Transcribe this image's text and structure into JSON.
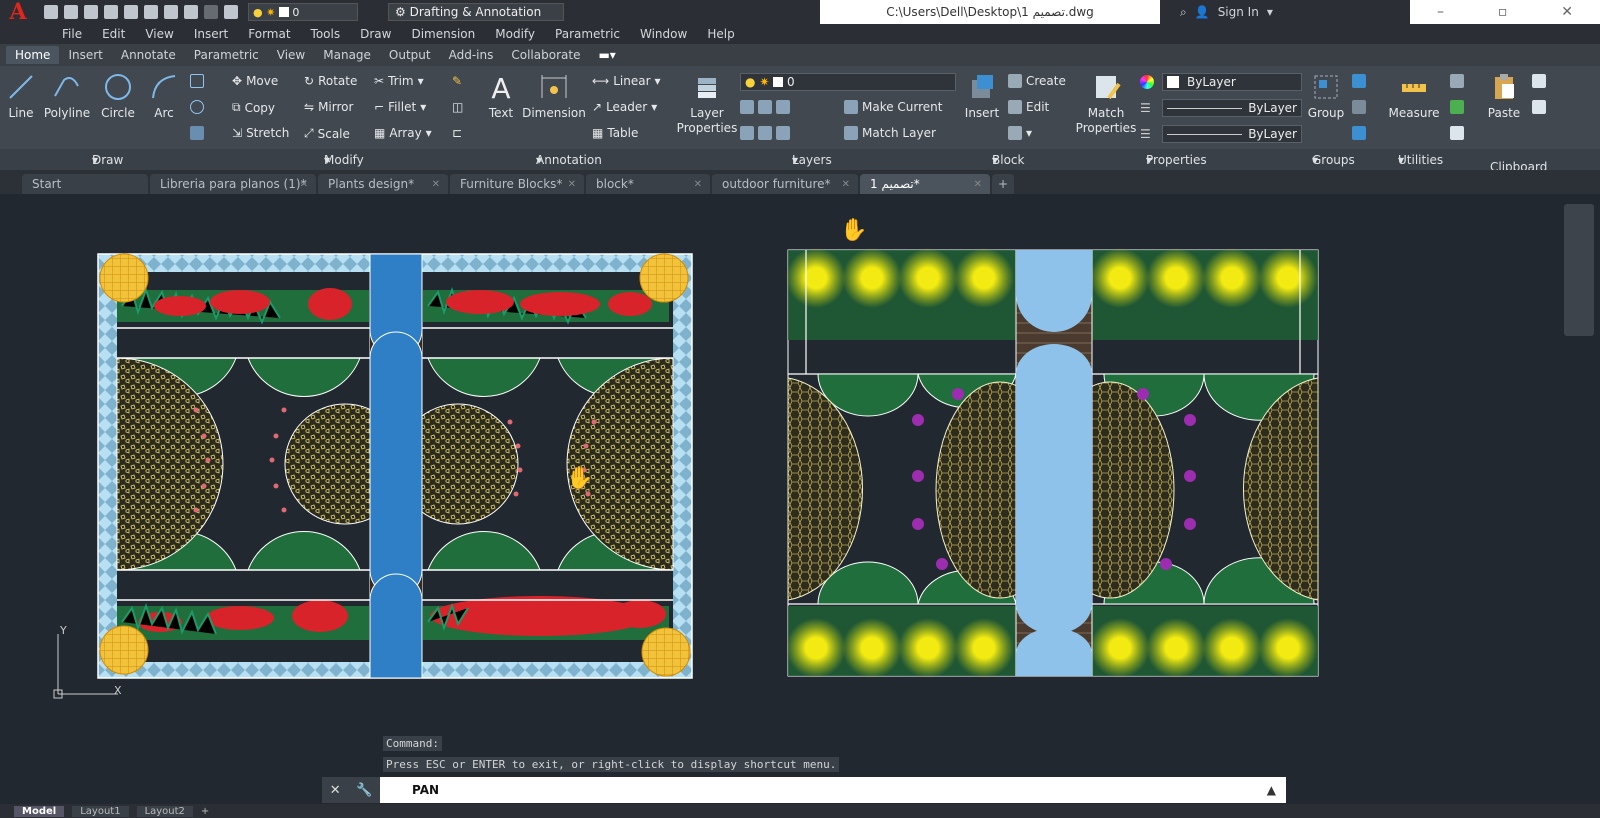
{
  "app": {
    "logo": "A",
    "layer_value": "0",
    "workspace": "Drafting & Annotation",
    "window_title": "C:\\Users\\Dell\\Desktop\\1 تصميم.dwg",
    "sign_in": "Sign In"
  },
  "menu": [
    "File",
    "Edit",
    "View",
    "Insert",
    "Format",
    "Tools",
    "Draw",
    "Dimension",
    "Modify",
    "Parametric",
    "Window",
    "Help"
  ],
  "ribbon_tabs": [
    "Home",
    "Insert",
    "Annotate",
    "Parametric",
    "View",
    "Manage",
    "Output",
    "Add-ins",
    "Collaborate"
  ],
  "draw": {
    "line": "Line",
    "polyline": "Polyline",
    "circle": "Circle",
    "arc": "Arc"
  },
  "modify": {
    "move": "Move",
    "rotate": "Rotate",
    "trim": "Trim",
    "copy": "Copy",
    "mirror": "Mirror",
    "fillet": "Fillet",
    "stretch": "Stretch",
    "scale": "Scale",
    "array": "Array"
  },
  "annotation": {
    "text": "Text",
    "dimension": "Dimension",
    "linear": "Linear",
    "leader": "Leader",
    "table": "Table"
  },
  "layers": {
    "properties_line1": "Layer",
    "properties_line2": "Properties",
    "current_layer": "0",
    "make_current": "Make Current",
    "match_layer": "Match Layer"
  },
  "block": {
    "insert": "Insert",
    "create": "Create",
    "edit": "Edit"
  },
  "properties": {
    "match_line1": "Match",
    "match_line2": "Properties",
    "color": "ByLayer",
    "linetype": "ByLayer",
    "lineweight": "ByLayer"
  },
  "groups": {
    "group": "Group"
  },
  "utilities": {
    "measure": "Measure"
  },
  "clipboard": {
    "paste": "Paste"
  },
  "panel_labels": {
    "draw": "Draw",
    "modify": "Modify",
    "annotation": "Annotation",
    "layers": "Layers",
    "block": "Block",
    "properties": "Properties",
    "groups": "Groups",
    "utilities": "Utilities",
    "clipboard": "Clipboard"
  },
  "doc_tabs": [
    "Start",
    "Libreria para planos (1)*",
    "Plants design*",
    "Furniture Blocks*",
    "block*",
    "outdoor furniture*",
    "1 تصميم*"
  ],
  "command": {
    "history_label": "Command:",
    "history_msg": "Press ESC or ENTER to exit, or right-click to display shortcut menu.",
    "current": "PAN"
  },
  "ucs": {
    "y": "Y",
    "x": "X"
  },
  "status_tabs": [
    "Model",
    "Layout1",
    "Layout2"
  ],
  "colors": {
    "water": "#2e7fc6",
    "water_light": "#8fc2ea",
    "lawn": "#1f6e3c",
    "hedge_red": "#d8232a",
    "hedge_green": "#1d9a6b",
    "flower_yellow": "#f2ea12",
    "hatch_light": "#a8d8f0",
    "gravel": "#c8b35a"
  }
}
